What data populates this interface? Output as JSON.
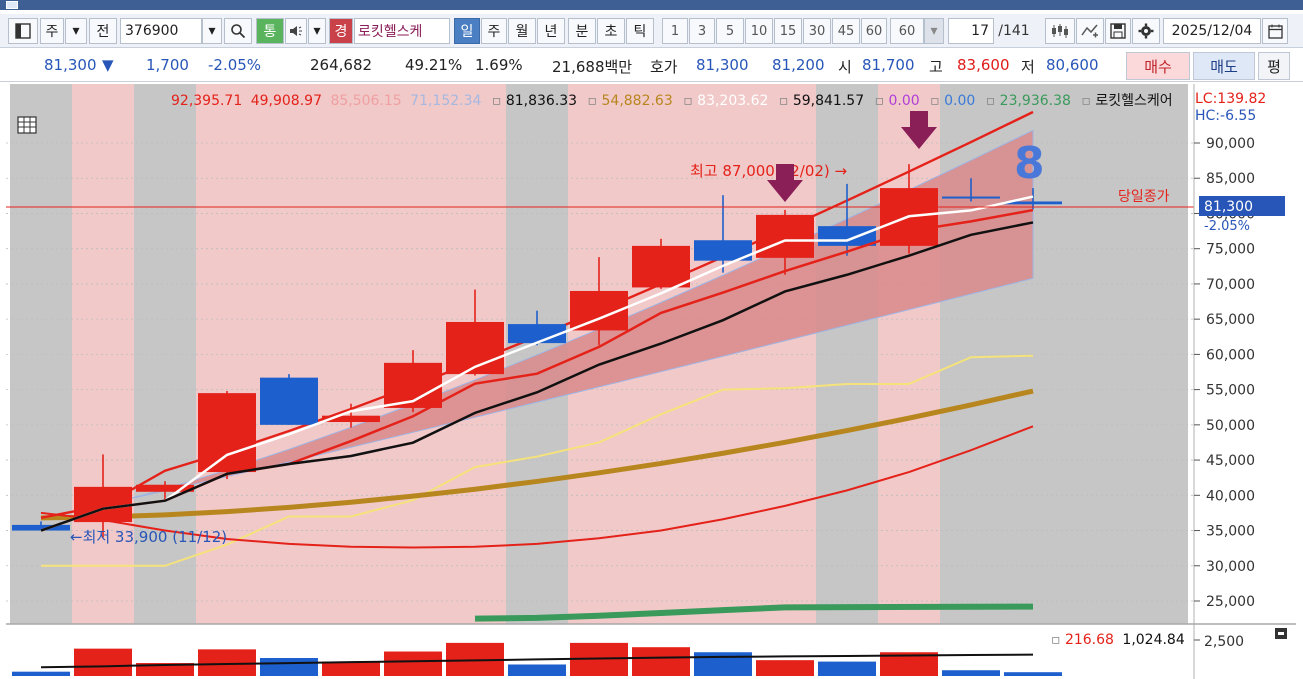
{
  "toolbar": {
    "market": "주",
    "period_prefix": "전",
    "code": "376900",
    "tong": "통",
    "gyeong": "경",
    "stock_name": "로킷헬스케",
    "tabs": [
      "일",
      "주",
      "월",
      "년",
      "분",
      "초",
      "틱"
    ],
    "nums": [
      "1",
      "3",
      "5",
      "10",
      "15",
      "30",
      "45",
      "60"
    ],
    "n_select": "60",
    "page": "17",
    "page_total": "/141",
    "date": "2025/12/04"
  },
  "infobar": {
    "price": "81,300",
    "arrow": "▼",
    "change": "1,700",
    "change_pct": "-2.05%",
    "volume": "264,682",
    "vol_ratio": "49.21%",
    "turnover": "1.69%",
    "amount": "21,688백만",
    "hoga_label": "호가",
    "ask": "81,300",
    "bid": "81,200",
    "open_label": "시",
    "open": "81,700",
    "high_label": "고",
    "high": "83,600",
    "low_label": "저",
    "low": "80,600",
    "buy": "매수",
    "sell": "매도",
    "pyeong": "평"
  },
  "legend": {
    "v1": "92,395.71",
    "v2": "49,908.97",
    "v3": "85,506.15",
    "v4": "71,152.34",
    "v5": "81,836.33",
    "v6": "54,882.63",
    "v7": "83,203.62",
    "v8": "59,841.57",
    "v9": "0.00",
    "v10": "0.00",
    "v11": "23,936.38",
    "name": "로킷헬스케어",
    "lc": "LC:139.82",
    "hc": "HC:-6.55"
  },
  "annotations": {
    "high": "최고 87,000(12/02) →",
    "low": "←최저 33,900 (11/12)",
    "count": "8",
    "close_label": "당일종가",
    "close_price": "81,300",
    "close_pct": "-2.05%"
  },
  "volume_legend": {
    "a": "216.68",
    "b": "1,024.84",
    "axis": "2,500"
  },
  "colors": {
    "up": "#e4221a",
    "down": "#1d5fcc",
    "band": "#d98a8a",
    "ma_gold": "#b8861e",
    "ma_green": "#3a9a5b"
  },
  "chart_data": {
    "type": "candlestick",
    "y_axis_ticks": [
      "90,000",
      "85,000",
      "80,000",
      "75,000",
      "70,000",
      "65,000",
      "60,000",
      "55,000",
      "50,000",
      "45,000",
      "40,000",
      "35,000",
      "30,000",
      "25,000"
    ],
    "ylim": [
      22000,
      94500
    ],
    "candles": [
      {
        "o": 35800,
        "h": 36300,
        "l": 35000,
        "c": 35000,
        "vol": 300
      },
      {
        "o": 36200,
        "h": 45800,
        "l": 34000,
        "c": 41200,
        "vol": 1900
      },
      {
        "o": 40500,
        "h": 42000,
        "l": 39300,
        "c": 41500,
        "vol": 900
      },
      {
        "o": 43300,
        "h": 54800,
        "l": 42300,
        "c": 54500,
        "vol": 1850
      },
      {
        "o": 56700,
        "h": 57200,
        "l": 50000,
        "c": 50000,
        "vol": 1250
      },
      {
        "o": 50400,
        "h": 53000,
        "l": 49600,
        "c": 51300,
        "vol": 1000
      },
      {
        "o": 52400,
        "h": 60600,
        "l": 51800,
        "c": 58800,
        "vol": 1700
      },
      {
        "o": 57200,
        "h": 69200,
        "l": 57000,
        "c": 64600,
        "vol": 2300
      },
      {
        "o": 64300,
        "h": 66200,
        "l": 61300,
        "c": 61600,
        "vol": 800
      },
      {
        "o": 63400,
        "h": 73800,
        "l": 61300,
        "c": 69000,
        "vol": 2300
      },
      {
        "o": 69500,
        "h": 76400,
        "l": 69300,
        "c": 75400,
        "vol": 2000
      },
      {
        "o": 76200,
        "h": 82600,
        "l": 71600,
        "c": 73300,
        "vol": 1650
      },
      {
        "o": 73700,
        "h": 80500,
        "l": 71300,
        "c": 79800,
        "vol": 1100
      },
      {
        "o": 78200,
        "h": 84200,
        "l": 74000,
        "c": 75400,
        "vol": 1000
      },
      {
        "o": 75400,
        "h": 87000,
        "l": 74300,
        "c": 83600,
        "vol": 1650
      },
      {
        "o": 82400,
        "h": 85000,
        "l": 81700,
        "c": 82300,
        "vol": 400
      },
      {
        "o": 81700,
        "h": 83600,
        "l": 80600,
        "c": 81300,
        "vol": 264
      }
    ],
    "volume_ma": [
      380,
      420,
      480,
      520,
      560,
      600,
      640,
      680,
      720,
      760,
      800,
      830,
      850,
      870,
      890,
      910,
      930
    ]
  }
}
